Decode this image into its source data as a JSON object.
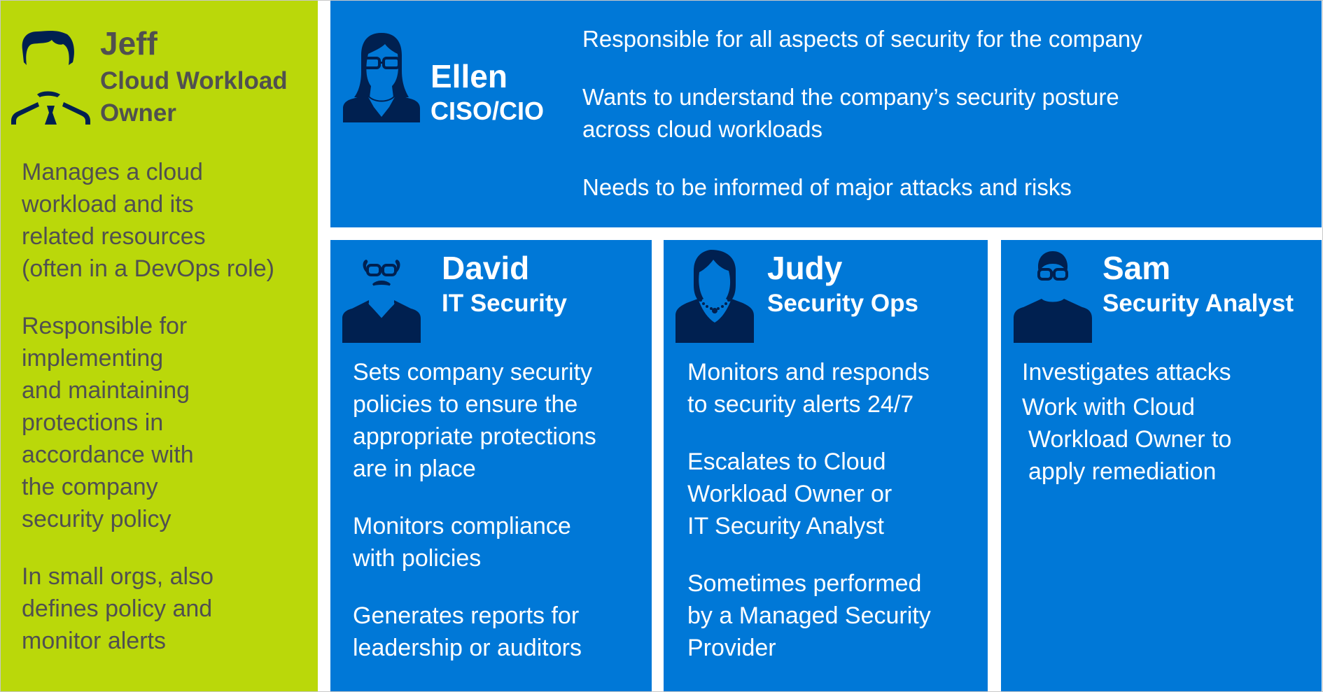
{
  "colors": {
    "green_panel": "#bad80a",
    "blue_panel": "#0078d7",
    "avatar": "#002050",
    "green_text": "#505050",
    "blue_text": "#ffffff"
  },
  "personas": {
    "jeff": {
      "name": "Jeff",
      "role_lines": [
        "Cloud Workload",
        "Owner"
      ],
      "icon": "man-with-tie-icon",
      "bullets": [
        [
          "Manages a cloud",
          "workload and its",
          "related resources",
          "(often in a DevOps role)"
        ],
        [
          "Responsible for",
          "implementing",
          "and maintaining",
          "protections in",
          "accordance with",
          "the company",
          "security policy"
        ],
        [
          "In small orgs, also",
          "defines policy and",
          "monitor alerts"
        ]
      ]
    },
    "ellen": {
      "name": "Ellen",
      "role_lines": [
        "CISO/CIO"
      ],
      "icon": "woman-with-glasses-icon",
      "bullets": [
        [
          "Responsible for all aspects of security for the company"
        ],
        [
          "Wants to understand the company’s security posture",
          "across cloud workloads"
        ],
        [
          "Needs to be informed of major attacks and risks"
        ]
      ]
    },
    "david": {
      "name": "David",
      "role_lines": [
        "IT Security"
      ],
      "icon": "man-with-glasses-mustache-icon",
      "bullets": [
        [
          "Sets company security",
          "policies to ensure the",
          "appropriate protections",
          "are in place"
        ],
        [
          "Monitors compliance",
          "with policies"
        ],
        [
          "Generates reports for",
          "leadership or auditors"
        ]
      ]
    },
    "judy": {
      "name": "Judy",
      "role_lines": [
        "Security Ops"
      ],
      "icon": "woman-with-necklace-icon",
      "bullets": [
        [
          "Monitors and responds",
          "to security alerts 24/7"
        ],
        [
          "Escalates to Cloud",
          "Workload Owner or",
          "IT Security Analyst"
        ],
        [
          "Sometimes performed",
          "by a Managed Security",
          "Provider"
        ]
      ]
    },
    "sam": {
      "name": "Sam",
      "role_lines": [
        "Security Analyst"
      ],
      "icon": "man-with-glasses-icon",
      "bullets": [
        [
          "Investigates attacks"
        ],
        [
          "Work with Cloud",
          "Workload Owner to",
          "apply remediation"
        ]
      ]
    }
  }
}
